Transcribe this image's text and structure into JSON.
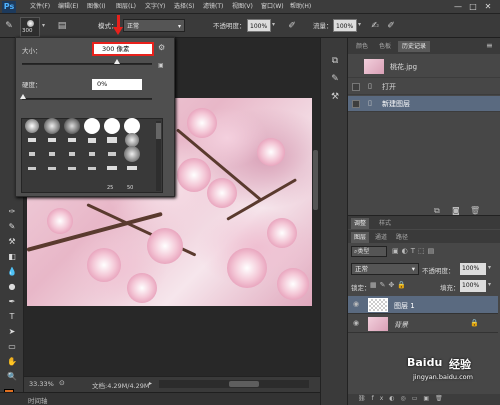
{
  "menubar": {
    "logo": "Ps",
    "items": [
      "文件(F)",
      "编辑(E)",
      "图像(I)",
      "图层(L)",
      "文字(Y)",
      "选择(S)",
      "滤镜(T)",
      "视图(V)",
      "窗口(W)",
      "帮助(H)"
    ],
    "window_buttons": [
      "—",
      "□",
      "✕"
    ]
  },
  "optbar": {
    "brush_size": "300",
    "mode_label": "模式：",
    "mode_value": "正常",
    "opacity_label": "不透明度：",
    "opacity_value": "100%",
    "flow_label": "流量：",
    "flow_value": "100%"
  },
  "brush_popup": {
    "size_label": "大小：",
    "size_value": "300 像素",
    "hardness_label": "硬度：",
    "hardness_value": "0%",
    "brush_numbers": [
      "25",
      "50"
    ]
  },
  "status": {
    "zoom": "33.33%",
    "doc_info": "文档:4.29M/4.29M"
  },
  "timeline": {
    "label": "时间轴"
  },
  "history": {
    "tabs": [
      "颜色",
      "色板",
      "历史记录"
    ],
    "snapshot": "桃花.jpg",
    "items": [
      "打开",
      "新建图层"
    ]
  },
  "layers": {
    "top_tabs": [
      "调整",
      "样式"
    ],
    "tabs": [
      "图层",
      "通道",
      "路径"
    ],
    "filter_label": "类型",
    "blend_mode": "正常",
    "opacity_label": "不透明度：",
    "opacity_value": "100%",
    "lock_label": "锁定：",
    "fill_label": "填充：",
    "fill_value": "100%",
    "rows": [
      "图层 1",
      "背景"
    ]
  },
  "watermark": {
    "brand": "Baidu",
    "text": "经验",
    "url": "jingyan.baidu.com"
  },
  "colors": {
    "selected_highlight": "#5a6a80",
    "red_annotation": "#e8211c",
    "foreground": "#e07020",
    "background": "#ffffff"
  }
}
